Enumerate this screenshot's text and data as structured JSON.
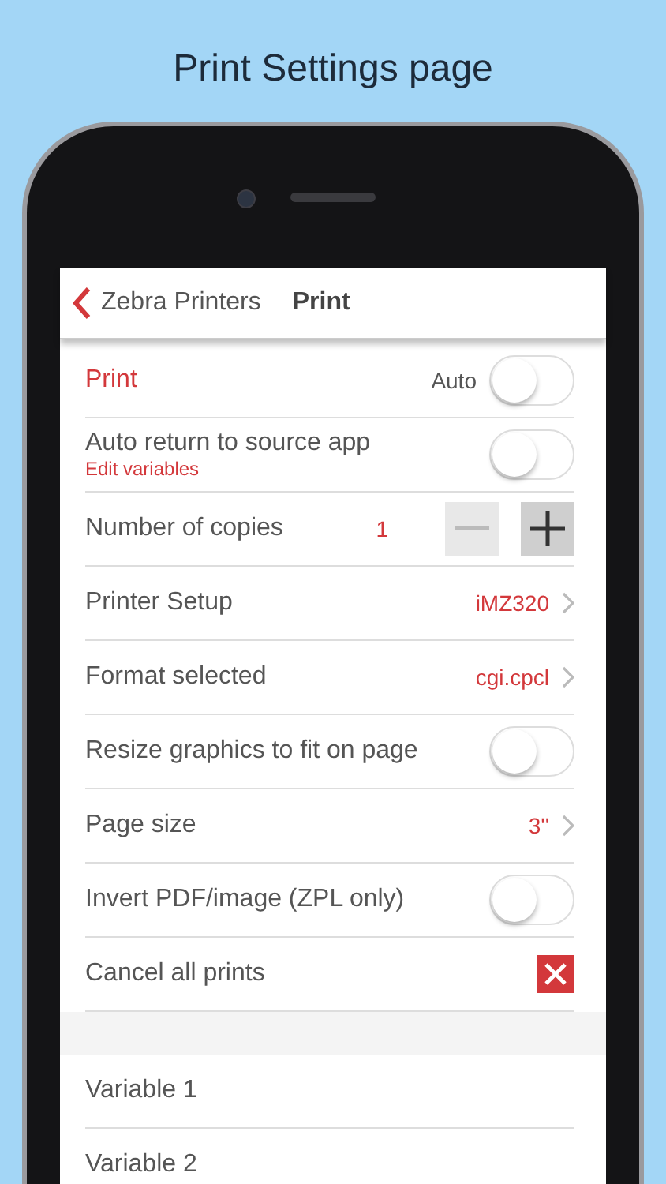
{
  "page_title": "Print Settings page",
  "nav": {
    "back_label": "Zebra Printers",
    "title": "Print"
  },
  "rows": [
    {
      "kind": "toggle",
      "label": "Print",
      "label_accent": true,
      "value": "Auto",
      "on": false
    },
    {
      "kind": "toggle",
      "label": "Auto return to source app",
      "sublabel": "Edit variables",
      "on": false
    },
    {
      "kind": "stepper",
      "label": "Number of copies",
      "value": "1"
    },
    {
      "kind": "link",
      "label": "Printer Setup",
      "value": "iMZ320"
    },
    {
      "kind": "link",
      "label": "Format selected",
      "value": "cgi.cpcl"
    },
    {
      "kind": "toggle",
      "label": "Resize graphics to fit on page",
      "on": false
    },
    {
      "kind": "link",
      "label": "Page size",
      "value": "3''"
    },
    {
      "kind": "toggle",
      "label": "Invert PDF/image (ZPL only)",
      "on": false
    },
    {
      "kind": "cancel",
      "label": "Cancel all prints"
    }
  ],
  "variables": [
    {
      "label": "Variable 1"
    },
    {
      "label": "Variable 2"
    }
  ]
}
